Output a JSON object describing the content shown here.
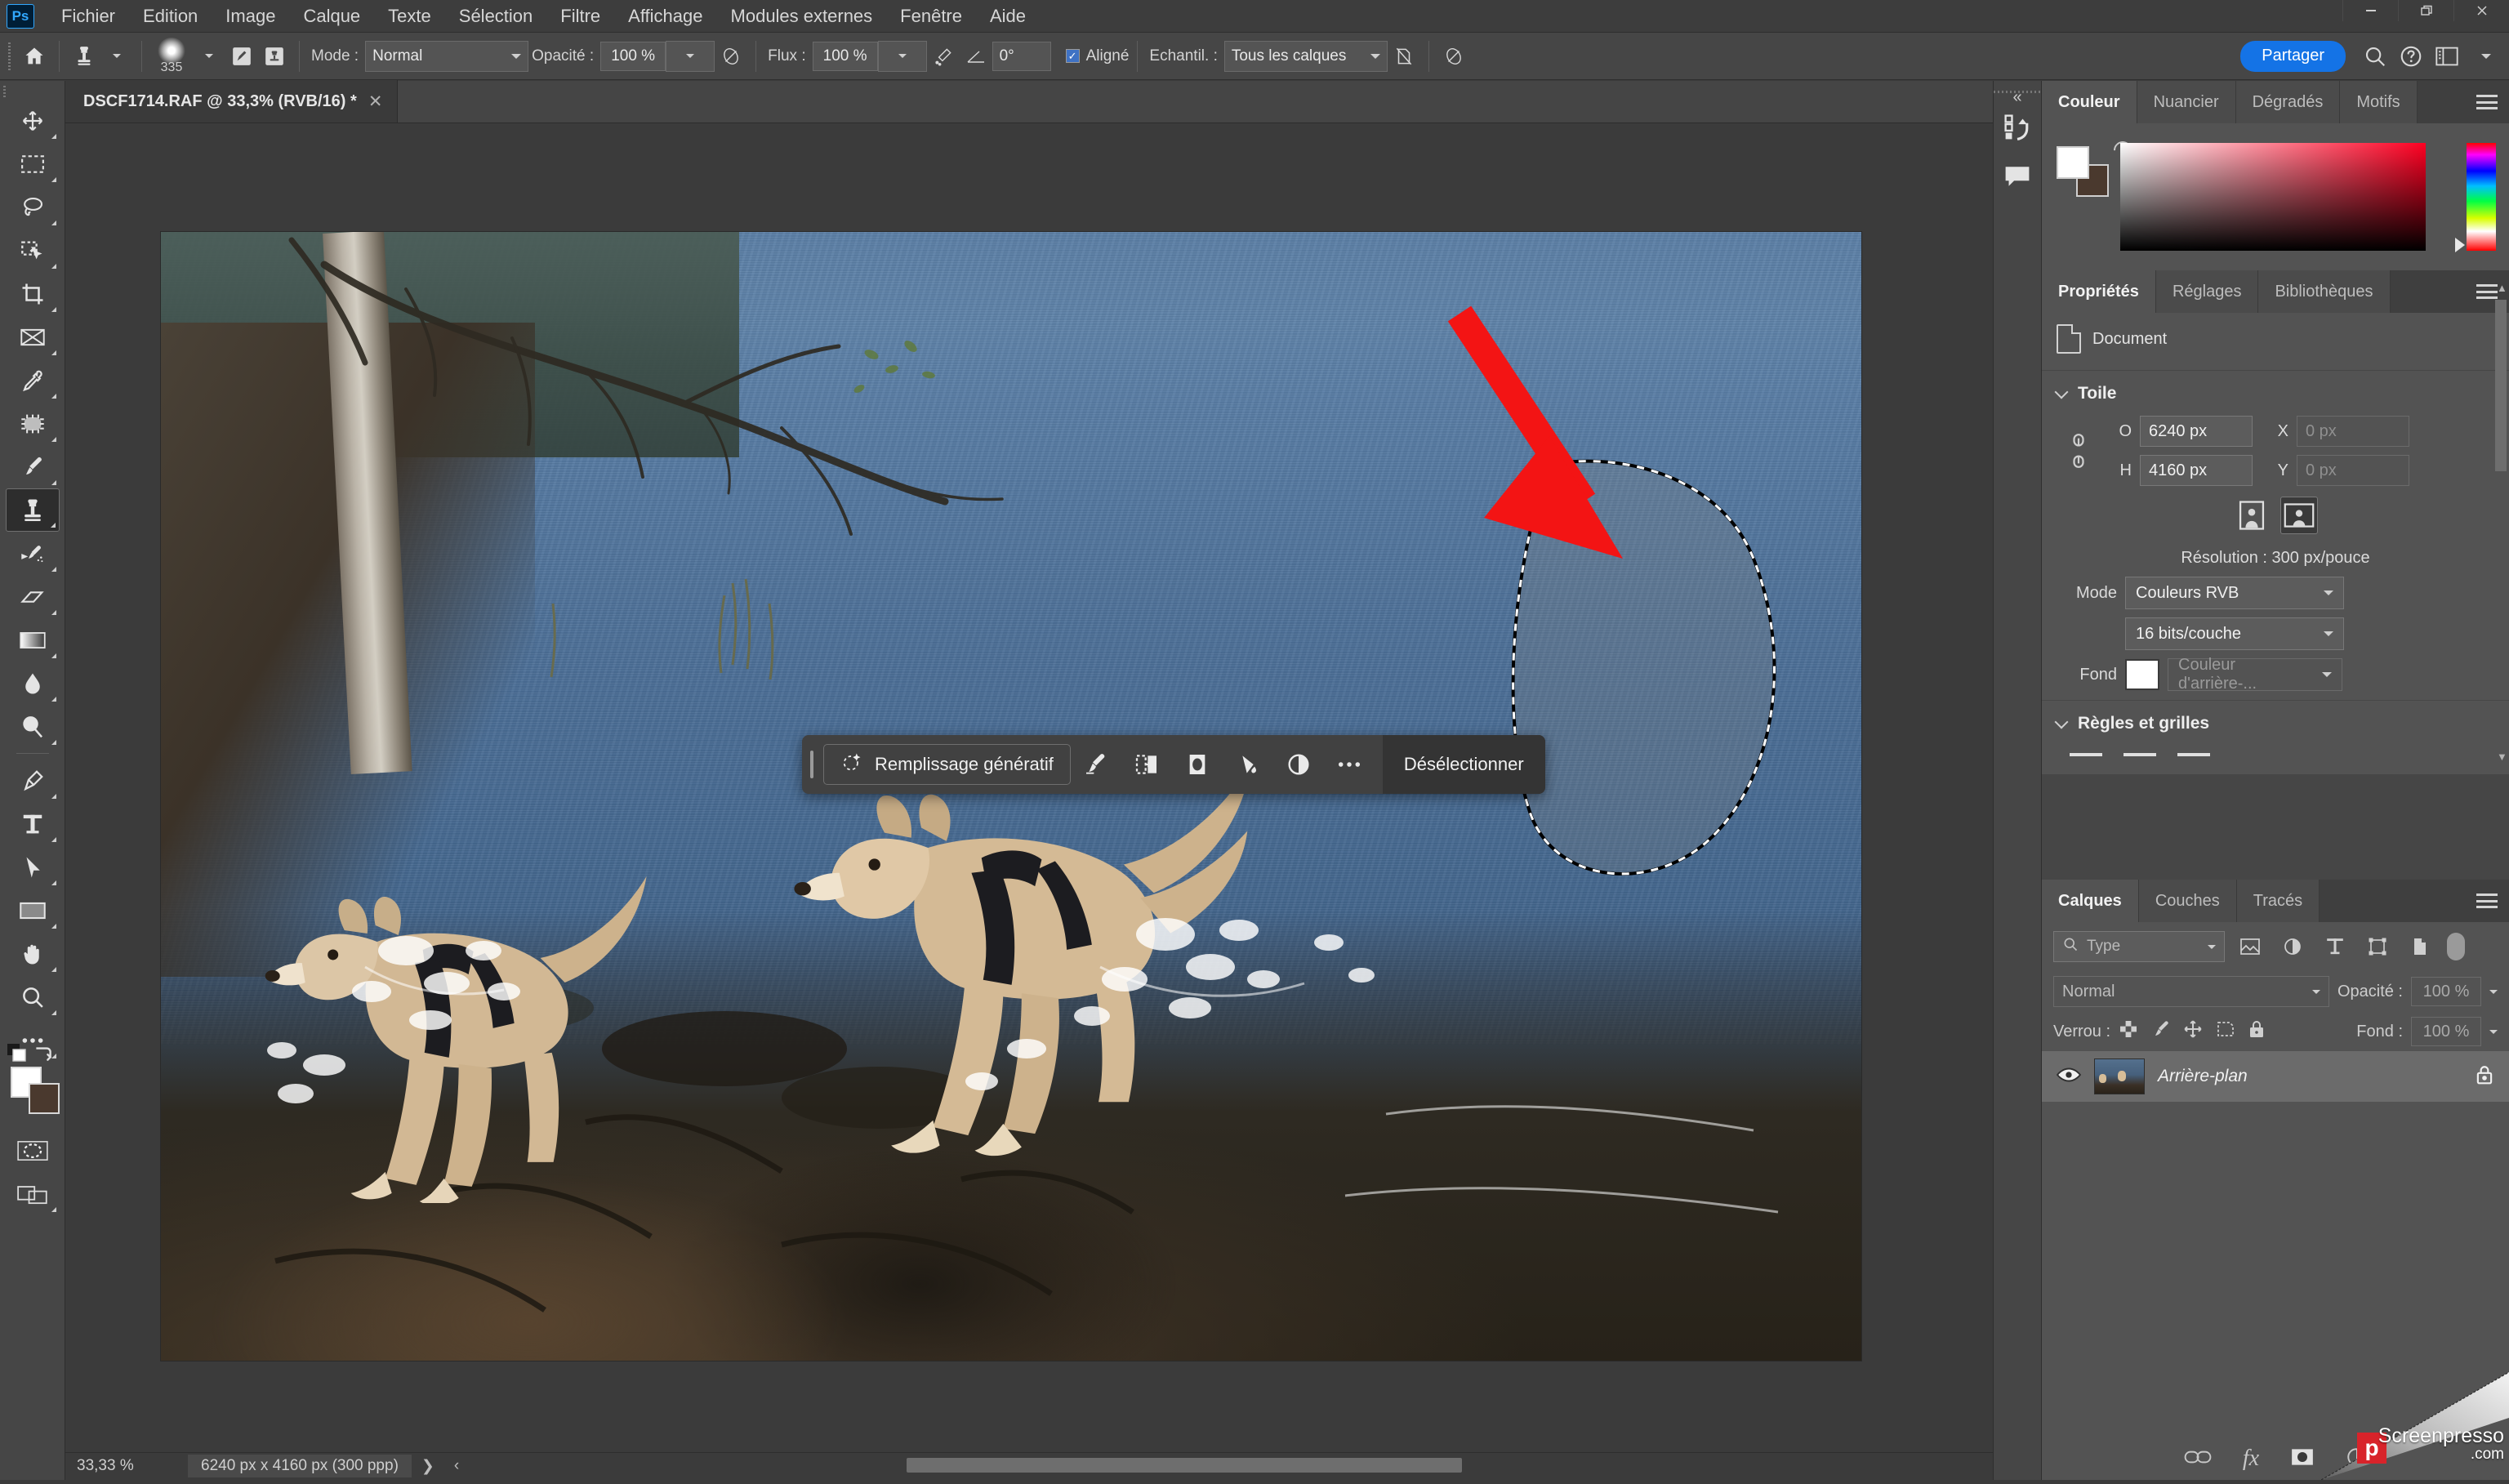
{
  "app": {
    "logo_label": "Ps",
    "menus": [
      "Fichier",
      "Edition",
      "Image",
      "Calque",
      "Texte",
      "Sélection",
      "Filtre",
      "Affichage",
      "Modules externes",
      "Fenêtre",
      "Aide"
    ],
    "window_controls": [
      "minimize-button",
      "restore-button",
      "close-button"
    ]
  },
  "options_bar": {
    "home_icon": "home-icon",
    "tool_icon": "clone-stamp-icon",
    "brush_size": "335",
    "brush_settings_icon": "brush-settings-icon",
    "brush_presets_icon": "brush-presets-icon",
    "mode_label": "Mode :",
    "mode_value": "Normal",
    "opacity_label": "Opacité :",
    "opacity_value": "100 %",
    "opacity_pressure_icon": "pressure-opacity-icon",
    "flow_label": "Flux :",
    "flow_value": "100 %",
    "airbrush_icon": "airbrush-icon",
    "angle_label": "angle-icon",
    "angle_value": "0°",
    "aligned_label": "Aligné",
    "aligned_checked": true,
    "sample_label": "Echantil. :",
    "sample_value": "Tous les calques",
    "ignore_adjust_icon": "ignore-adjustment-layers-icon",
    "pressure_size_icon": "pressure-size-icon",
    "share_label": "Partager",
    "search_icon": "search-icon",
    "help_icon": "help-icon",
    "workspace_icon": "workspace-icon",
    "workspace_caret": "chevron-down-icon"
  },
  "document_tab": {
    "title": "DSCF1714.RAF @ 33,3% (RVB/16) *",
    "close_icon": "close-icon"
  },
  "toolbar": {
    "tools": [
      {
        "name": "move-tool",
        "glyph": "move"
      },
      {
        "name": "rectangular-marquee-tool",
        "glyph": "marquee"
      },
      {
        "name": "lasso-tool",
        "glyph": "lasso"
      },
      {
        "name": "object-selection-tool",
        "glyph": "objsel"
      },
      {
        "name": "crop-tool",
        "glyph": "crop"
      },
      {
        "name": "frame-tool",
        "glyph": "frame"
      },
      {
        "name": "eyedropper-tool",
        "glyph": "eyedropper"
      },
      {
        "name": "spot-healing-brush-tool",
        "glyph": "healing"
      },
      {
        "name": "brush-tool",
        "glyph": "brush"
      },
      {
        "name": "clone-stamp-tool",
        "glyph": "stamp",
        "active": true
      },
      {
        "name": "history-brush-tool",
        "glyph": "historybrush"
      },
      {
        "name": "eraser-tool",
        "glyph": "eraser"
      },
      {
        "name": "gradient-tool",
        "glyph": "gradient"
      },
      {
        "name": "blur-tool",
        "glyph": "blur"
      },
      {
        "name": "dodge-tool",
        "glyph": "dodge"
      },
      {
        "name": "pen-tool",
        "glyph": "pen"
      },
      {
        "name": "type-tool",
        "glyph": "type"
      },
      {
        "name": "path-selection-tool",
        "glyph": "pathsel"
      },
      {
        "name": "rectangle-tool",
        "glyph": "rect"
      },
      {
        "name": "hand-tool",
        "glyph": "hand"
      },
      {
        "name": "zoom-tool",
        "glyph": "zoom"
      },
      {
        "name": "edit-toolbar-button",
        "glyph": "dots"
      }
    ],
    "foreground_color": "#ffffff",
    "background_color": "#4a392e",
    "swap_icon": "swap-colors-icon",
    "default_colors_icon": "default-colors-icon",
    "quick_mask_icon": "quick-mask-icon",
    "screen_mode_icon": "screen-mode-icon"
  },
  "contextual_task_bar": {
    "grip_icon": "drag-handle-icon",
    "generative_fill_label": "Remplissage génératif",
    "sparkle_icon": "generative-sparkle-icon",
    "icons": [
      {
        "name": "select-and-mask-icon"
      },
      {
        "name": "feather-selection-icon"
      },
      {
        "name": "invert-selection-icon"
      },
      {
        "name": "fill-selection-icon"
      },
      {
        "name": "adjustment-layer-icon"
      },
      {
        "name": "more-options-icon"
      }
    ],
    "deselect_label": "Désélectionner"
  },
  "canvas": {
    "image_alt": "Two dogs running through shallow lake water at a wooded shoreline",
    "selection_name": "elliptical-selection-marquee",
    "annotation_arrow": "red-arrow-annotation"
  },
  "status_bar": {
    "zoom": "33,33 %",
    "dimensions": "6240 px x 4160 px (300 ppp)",
    "expand_icon": "chevron-right-icon",
    "resize_icon": "resize-grip-icon"
  },
  "dock_strip": {
    "collapse_icon": "collapse-panels-icon",
    "buttons": [
      {
        "name": "history-panel-icon"
      },
      {
        "name": "comments-panel-icon"
      }
    ]
  },
  "color_panel": {
    "tabs": [
      "Couleur",
      "Nuancier",
      "Dégradés",
      "Motifs"
    ],
    "active_tab": "Couleur",
    "menu_icon": "panel-menu-icon",
    "foreground_color": "#ffffff",
    "background_color": "#4a392e",
    "reset_icon": "reset-colors-icon",
    "spectrum_name": "color-field",
    "hue_slider_name": "hue-slider"
  },
  "properties_panel": {
    "tabs": [
      "Propriétés",
      "Réglages",
      "Bibliothèques"
    ],
    "active_tab": "Propriétés",
    "menu_icon": "panel-menu-icon",
    "header": "Document",
    "header_icon": "document-icon",
    "canvas_section": {
      "title": "Toile",
      "link_icon": "link-dimensions-icon",
      "width_label": "O",
      "width_value": "6240 px",
      "height_label": "H",
      "height_value": "4160 px",
      "x_label": "X",
      "x_placeholder": "0 px",
      "y_label": "Y",
      "y_placeholder": "0 px",
      "orientation_portrait": "portrait-orientation-icon",
      "orientation_landscape": "landscape-orientation-icon",
      "resolution": "Résolution : 300 px/pouce",
      "mode_label": "Mode",
      "mode_value": "Couleurs RVB",
      "depth_value": "16 bits/couche",
      "fill_label": "Fond",
      "fill_color": "#ffffff",
      "fill_value": "Couleur d'arrière-..."
    },
    "rulers_section": {
      "title": "Règles et grilles"
    }
  },
  "layers_panel": {
    "tabs": [
      "Calques",
      "Couches",
      "Tracés"
    ],
    "active_tab": "Calques",
    "menu_icon": "panel-menu-icon",
    "filter_placeholder": "Type",
    "filter_icons": [
      {
        "name": "filter-pixel-icon"
      },
      {
        "name": "filter-adjustment-icon"
      },
      {
        "name": "filter-type-icon"
      },
      {
        "name": "filter-shape-icon"
      },
      {
        "name": "filter-smart-object-icon"
      }
    ],
    "filter_toggle": "filter-enable-toggle",
    "blend_mode": "Normal",
    "opacity_label": "Opacité :",
    "opacity_value": "100 %",
    "lock_label": "Verrou :",
    "lock_icons": [
      {
        "name": "lock-transparency-icon"
      },
      {
        "name": "lock-image-icon"
      },
      {
        "name": "lock-position-icon"
      },
      {
        "name": "lock-artboard-icon"
      },
      {
        "name": "lock-all-icon"
      }
    ],
    "fill_label": "Fond :",
    "fill_value": "100 %",
    "layers": [
      {
        "name": "Arrière-plan",
        "visible": true,
        "locked": true,
        "eye_icon": "layer-visibility-icon",
        "lock_icon": "layer-lock-icon"
      }
    ],
    "bottom_icons": [
      {
        "name": "link-layers-icon",
        "glyph": "link"
      },
      {
        "name": "layer-styles-icon",
        "glyph": "fx"
      },
      {
        "name": "layer-mask-icon",
        "glyph": "mask"
      },
      {
        "name": "new-adjustment-layer-icon",
        "glyph": "adj"
      }
    ]
  },
  "watermark": {
    "brand": "Screenpresso",
    "domain": ".com",
    "logo_letter": "p"
  }
}
